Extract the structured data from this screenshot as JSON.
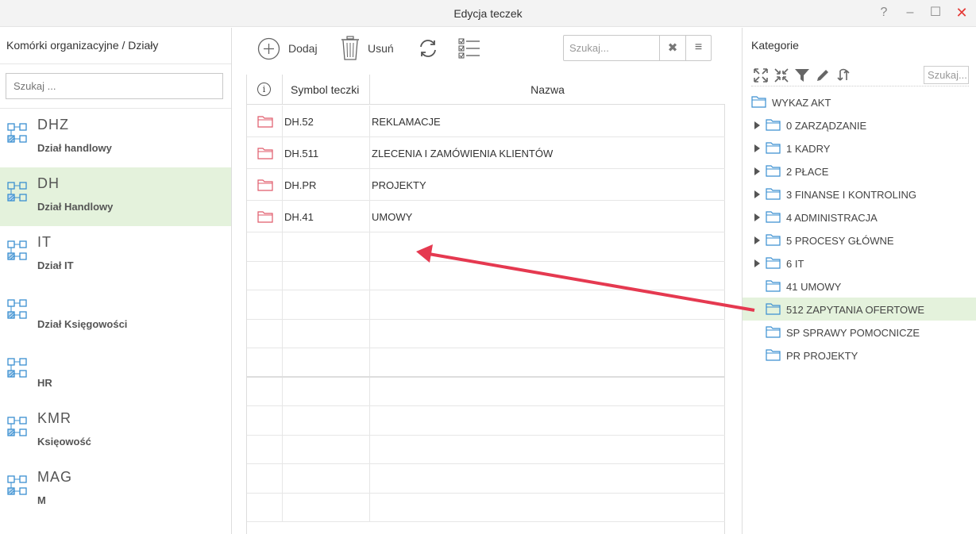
{
  "window": {
    "title": "Edycja teczek",
    "help_glyph": "?",
    "minimize_glyph": "–",
    "maximize_glyph": "☐",
    "close_glyph": "✕",
    "accent_color": "#e4f2dc"
  },
  "left": {
    "header": "Komórki organizacyjne / Działy",
    "search_placeholder": "Szukaj ...",
    "items": [
      {
        "code": "DHZ",
        "name": "Dział handlowy",
        "icon": "org-structure-icon"
      },
      {
        "code": "DH",
        "name": "Dział Handlowy",
        "icon": "org-structure-icon",
        "selected": true
      },
      {
        "code": "IT",
        "name": "Dział IT",
        "icon": "org-structure-icon"
      },
      {
        "code": "",
        "name": "Dział Księgowości",
        "icon": "org-structure-icon"
      },
      {
        "code": "",
        "name": "HR",
        "icon": "org-structure-icon"
      },
      {
        "code": "KMR",
        "name": "Księowość",
        "icon": "org-structure-icon"
      },
      {
        "code": "MAG",
        "name": "M",
        "icon": "org-structure-icon"
      }
    ]
  },
  "toolbar": {
    "add_label": "Dodaj",
    "delete_label": "Usuń",
    "search_placeholder": "Szukaj...",
    "clear_glyph": "✖",
    "menu_glyph": "≡"
  },
  "grid": {
    "info_glyph": "i",
    "columns": [
      "Symbol teczki",
      "Nazwa"
    ],
    "rows": [
      {
        "symbol": "DH.52",
        "name": "REKLAMACJE"
      },
      {
        "symbol": "DH.511",
        "name": "ZLECENIA I ZAMÓWIENIA KLIENTÓW"
      },
      {
        "symbol": "DH.PR",
        "name": "PROJEKTY"
      },
      {
        "symbol": "DH.41",
        "name": "UMOWY"
      }
    ]
  },
  "right": {
    "header": "Kategorie",
    "search_placeholder": "Szukaj...",
    "tree": [
      {
        "label": "WYKAZ AKT",
        "level": 0,
        "expandable": false
      },
      {
        "label": "0 ZARZĄDZANIE",
        "level": 1,
        "expandable": true
      },
      {
        "label": "1 KADRY",
        "level": 1,
        "expandable": true
      },
      {
        "label": "2 PŁACE",
        "level": 1,
        "expandable": true
      },
      {
        "label": "3 FINANSE I KONTROLING",
        "level": 1,
        "expandable": true
      },
      {
        "label": "4 ADMINISTRACJA",
        "level": 1,
        "expandable": true
      },
      {
        "label": "5 PROCESY GŁÓWNE",
        "level": 1,
        "expandable": true
      },
      {
        "label": "6 IT",
        "level": 1,
        "expandable": true
      },
      {
        "label": "41 UMOWY",
        "level": 1,
        "expandable": false
      },
      {
        "label": "512 ZAPYTANIA OFERTOWE",
        "level": 1,
        "expandable": false,
        "selected": true
      },
      {
        "label": "SP SPRAWY POMOCNICZE",
        "level": 1,
        "expandable": false
      },
      {
        "label": "PR PROJEKTY",
        "level": 1,
        "expandable": false
      }
    ]
  }
}
